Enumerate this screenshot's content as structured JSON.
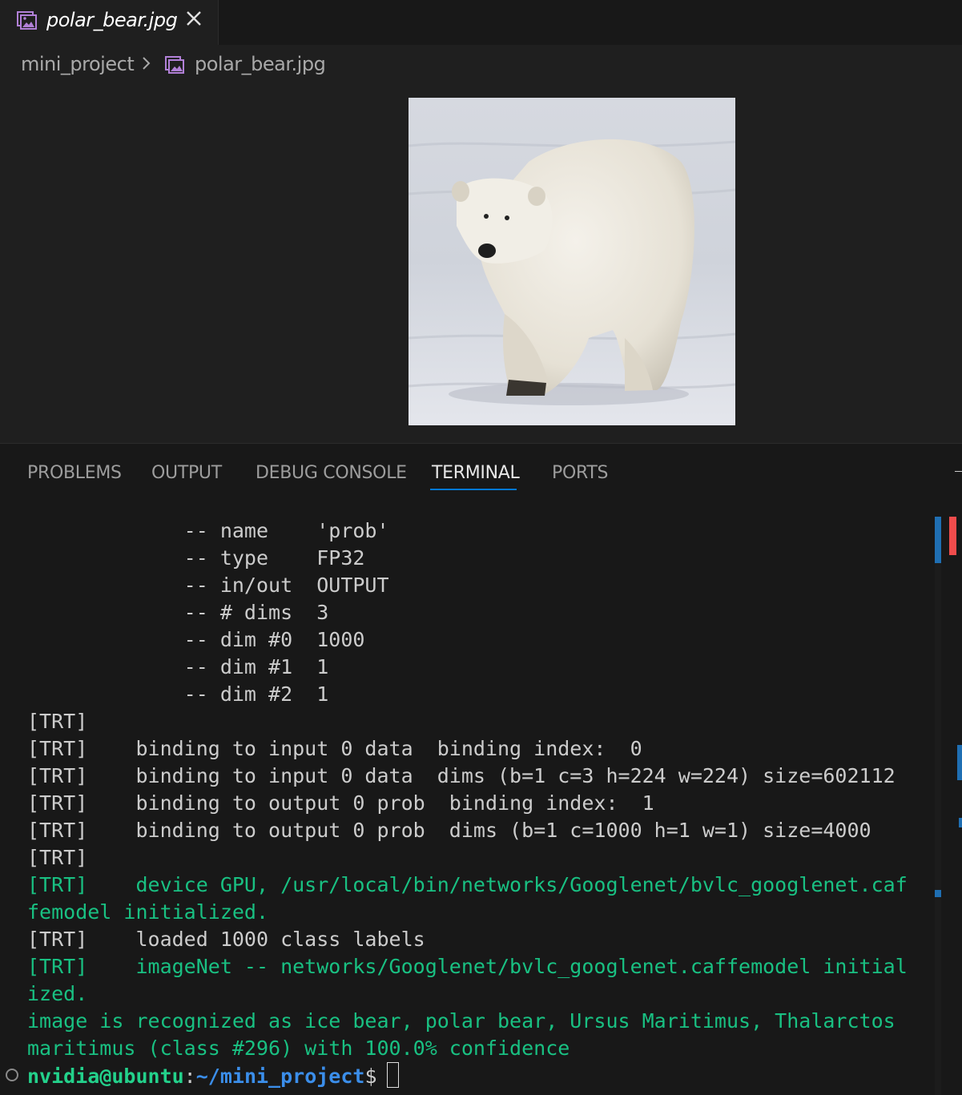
{
  "editor_tab": {
    "title": "polar_bear.jpg",
    "icon": "image-file-icon",
    "close_icon": "close-icon"
  },
  "breadcrumb": {
    "folder": "mini_project",
    "separator": ">",
    "file": "polar_bear.jpg"
  },
  "preview": {
    "alt": "polar bear"
  },
  "panel": {
    "tabs": [
      "PROBLEMS",
      "OUTPUT",
      "DEBUG CONSOLE",
      "TERMINAL",
      "PORTS"
    ],
    "active_tab": "TERMINAL"
  },
  "terminal": {
    "lines": [
      "             -- name    'prob'",
      "             -- type    FP32",
      "             -- in/out  OUTPUT",
      "             -- # dims  3",
      "             -- dim #0  1000",
      "             -- dim #1  1",
      "             -- dim #2  1",
      "[TRT]",
      "[TRT]    binding to input 0 data  binding index:  0",
      "[TRT]    binding to input 0 data  dims (b=1 c=3 h=224 w=224) size=602112",
      "[TRT]    binding to output 0 prob  binding index:  1",
      "[TRT]    binding to output 0 prob  dims (b=1 c=1000 h=1 w=1) size=4000",
      "[TRT]",
      "[TRT]    device GPU, /usr/local/bin/networks/Googlenet/bvlc_googlenet.caf",
      "femodel initialized.",
      "[TRT]    loaded 1000 class labels",
      "[TRT]    imageNet -- networks/Googlenet/bvlc_googlenet.caffemodel initial",
      "ized.",
      "image is recognized as ice bear, polar bear, Ursus Maritimus, Thalarctos",
      "maritimus (class #296) with 100.0% confidence"
    ],
    "green_lines": [
      13,
      14,
      16,
      17,
      18,
      19
    ],
    "prompt": {
      "user": "nvidia@ubuntu",
      "sep": ":",
      "path": "~/mini_project",
      "symbol": "$"
    }
  },
  "colors": {
    "editor_bg": "#1f1f1f",
    "panel_bg": "#181818",
    "accent": "#0078d4",
    "terminal_green": "#23d18b",
    "terminal_blue": "#3b8eea"
  }
}
